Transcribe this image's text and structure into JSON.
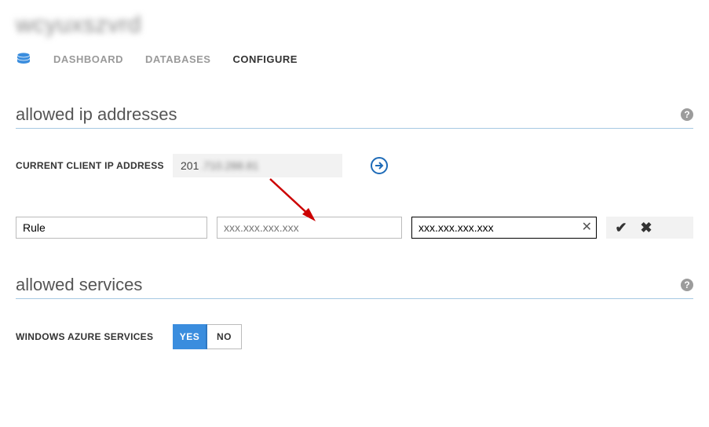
{
  "header": {
    "title": "wcyuxszvrd"
  },
  "tabs": {
    "dashboard": "DASHBOARD",
    "databases": "DATABASES",
    "configure": "CONFIGURE"
  },
  "sections": {
    "allowed_ip": {
      "title": "allowed ip addresses",
      "client_ip_label": "CURRENT CLIENT IP ADDRESS",
      "client_ip_value_visible": "201",
      "client_ip_value_obscured": ".710.288.81",
      "rule": {
        "name": "Rule",
        "start_placeholder": "xxx.xxx.xxx.xxx",
        "end_value": "xxx.xxx.xxx.xxx"
      }
    },
    "allowed_services": {
      "title": "allowed services",
      "label": "WINDOWS AZURE SERVICES",
      "yes": "YES",
      "no": "NO"
    }
  },
  "help_tooltip": "?"
}
